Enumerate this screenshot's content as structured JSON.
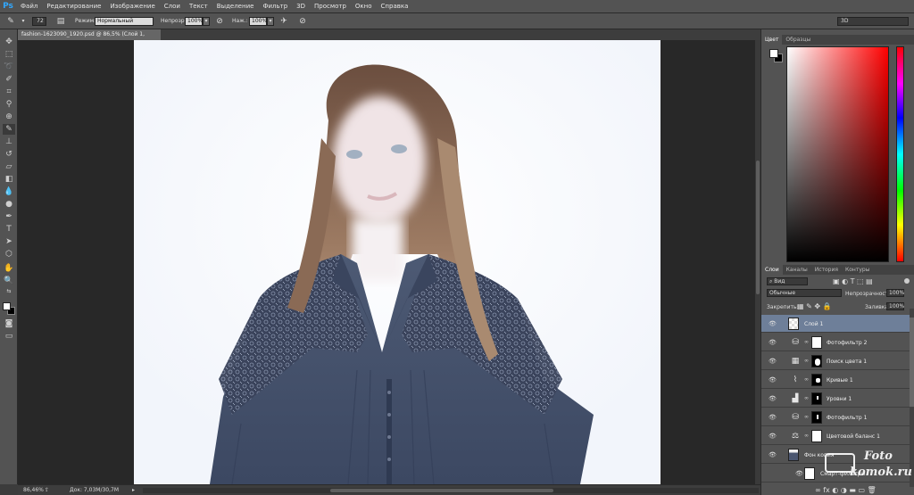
{
  "app": {
    "logo": "Ps"
  },
  "menu": [
    "Файл",
    "Редактирование",
    "Изображение",
    "Слои",
    "Текст",
    "Выделение",
    "Фильтр",
    "3D",
    "Просмотр",
    "Окно",
    "Справка"
  ],
  "options": {
    "brush_size": "72",
    "mode_label": "Режим:",
    "mode_value": "Нормальный",
    "opacity_label": "Непрозр.:",
    "opacity_value": "100%",
    "pressure_label": "Наж.:",
    "pressure_value": "100%",
    "workspace": "3D"
  },
  "document": {
    "tab_title": "fashion-1623090_1920.psd @ 86,5% (Слой 1, RGB/8) *",
    "zoom": "86,46%",
    "doc_size": "Док: 7,03M/30,7M"
  },
  "color_panel": {
    "tabs": [
      "Цвет",
      "Образцы"
    ],
    "fg": "#ffffff",
    "bg": "#000000"
  },
  "layers_panel": {
    "tabs": [
      "Слои",
      "Каналы",
      "История",
      "Контуры"
    ],
    "filter": "Вид",
    "blend_mode": "Обычные",
    "opacity_label": "Непрозрачность:",
    "opacity_value": "100%",
    "lock_label": "Закрепить:",
    "fill_label": "Заливка:",
    "fill_value": "100%",
    "layers": [
      {
        "name": "Слой 1",
        "icon": "layer-thumb",
        "selected": true
      },
      {
        "name": "Фотофильтр 2",
        "icon": "photo-filter-icon"
      },
      {
        "name": "Поиск цвета 1",
        "icon": "color-lookup-icon"
      },
      {
        "name": "Кривые 1",
        "icon": "curves-icon"
      },
      {
        "name": "Уровни 1",
        "icon": "levels-icon"
      },
      {
        "name": "Фотофильтр 1",
        "icon": "photo-filter-icon"
      },
      {
        "name": "Цветовой баланс 1",
        "icon": "color-balance-icon"
      },
      {
        "name": "Фон копия",
        "icon": "smart-object-thumb"
      },
      {
        "name": "Смарт-фильтры",
        "icon": "smart-filter-thumb"
      }
    ]
  },
  "watermark": {
    "line1": "Foto",
    "line2": "komok.ru"
  }
}
